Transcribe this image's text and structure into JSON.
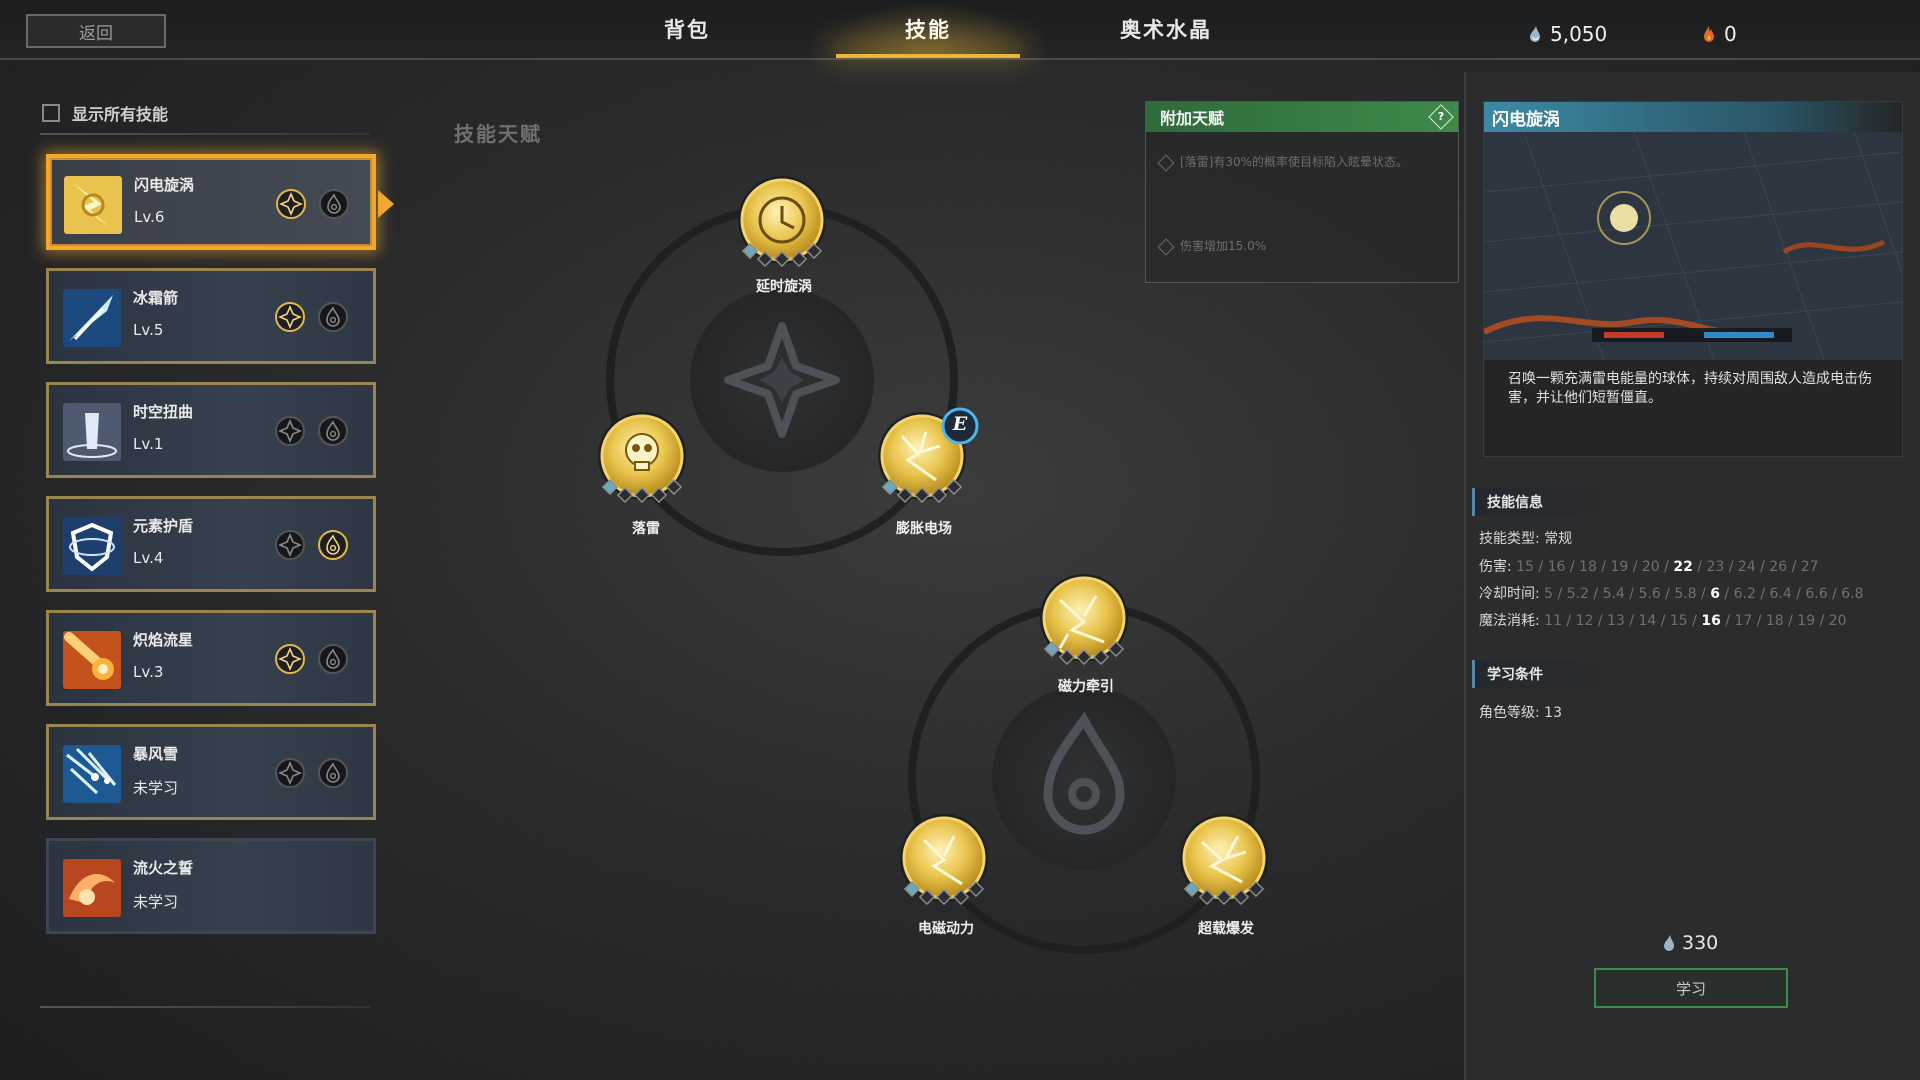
{
  "topbar": {
    "back_label": "返回",
    "tabs": [
      {
        "label": "背包",
        "active": false
      },
      {
        "label": "技能",
        "active": true
      },
      {
        "label": "奥术水晶",
        "active": false
      }
    ],
    "currency_mana": "5,050",
    "currency_fire": "0"
  },
  "left": {
    "show_all_label": "显示所有技能",
    "skills": [
      {
        "name": "闪电旋涡",
        "level": "Lv.6",
        "selected": true
      },
      {
        "name": "冰霜箭",
        "level": "Lv.5"
      },
      {
        "name": "时空扭曲",
        "level": "Lv.1"
      },
      {
        "name": "元素护盾",
        "level": "Lv.4"
      },
      {
        "name": "炽焰流星",
        "level": "Lv.3"
      },
      {
        "name": "暴风雪",
        "level": "未学习"
      },
      {
        "name": "流火之誓",
        "level": "未学习"
      }
    ]
  },
  "center": {
    "section_title": "技能天赋",
    "tree1": {
      "nodes": [
        "延时旋涡",
        "落雷",
        "膨胀电场"
      ],
      "badge": "E"
    },
    "tree2": {
      "nodes": [
        "磁力牵引",
        "电磁动力",
        "超载爆发"
      ]
    }
  },
  "talent_box": {
    "title": "附加天赋",
    "help_icon": "?",
    "lines": [
      "[落雷]有30%的概率使目标陷入眩晕状态。",
      "伤害增加15.0%"
    ]
  },
  "right": {
    "skill_title": "闪电旋涡",
    "description": "召唤一颗充满雷电能量的球体，持续对周围敌人造成电击伤害，并让他们短暂僵直。",
    "info_title": "技能信息",
    "type_label": "技能类型:",
    "type_value": "常规",
    "damage_label": "伤害:",
    "damage_before": "15 / 16 / 18 / 19 / 20 / ",
    "damage_current": "22",
    "damage_after": " / 23 / 24 / 26 / 27",
    "cooldown_label": "冷却时间:",
    "cooldown_before": "5 / 5.2 / 5.4 / 5.6 / 5.8 / ",
    "cooldown_current": "6",
    "cooldown_after": " / 6.2 / 6.4 / 6.6 / 6.8",
    "mana_label": "魔法消耗:",
    "mana_before": "11 / 12 / 13 / 14 / 15 / ",
    "mana_current": "16",
    "mana_after": " / 17 / 18 / 19 / 20",
    "req_title": "学习条件",
    "req_text": "角色等级: 13",
    "cost": "330",
    "learn_label": "学习"
  },
  "colors": {
    "accent_gold": "#f2a72e",
    "talent_green": "#3e8a49",
    "preview_blue": "#3d8aa6"
  }
}
